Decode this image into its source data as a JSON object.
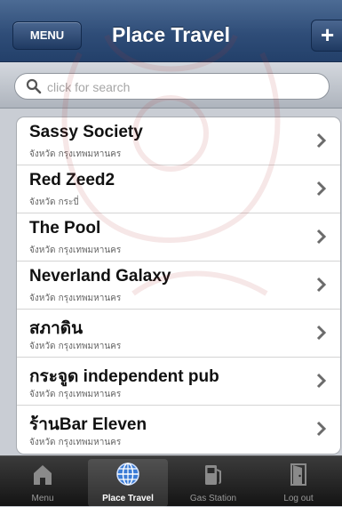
{
  "navbar": {
    "menu_label": "MENU",
    "title": "Place Travel",
    "add_label": "+"
  },
  "search": {
    "placeholder": "click for search"
  },
  "places": [
    {
      "name": "Sassy  Society",
      "province": "จังหวัด กรุงเทพมหานคร"
    },
    {
      "name": "Red Zeed2",
      "province": "จังหวัด กระบี่"
    },
    {
      "name": "The Pool",
      "province": "จังหวัด กรุงเทพมหานคร"
    },
    {
      "name": "Neverland Galaxy",
      "province": "จังหวัด กรุงเทพมหานคร"
    },
    {
      "name": "สภาดิน",
      "province": "จังหวัด กรุงเทพมหานคร"
    },
    {
      "name": "กระจูด independent pub",
      "province": "จังหวัด กรุงเทพมหานคร"
    },
    {
      "name": "ร้านBar Eleven",
      "province": "จังหวัด กรุงเทพมหานคร"
    }
  ],
  "tabs": [
    {
      "label": "Menu",
      "icon": "home-icon"
    },
    {
      "label": "Place Travel",
      "icon": "globe-icon",
      "selected": true
    },
    {
      "label": "Gas Station",
      "icon": "gas-pump-icon"
    },
    {
      "label": "Log out",
      "icon": "door-icon"
    }
  ],
  "colors": {
    "navbar": "#2f4d78",
    "tabbar": "#141414",
    "globe": "#3a7bd5"
  }
}
